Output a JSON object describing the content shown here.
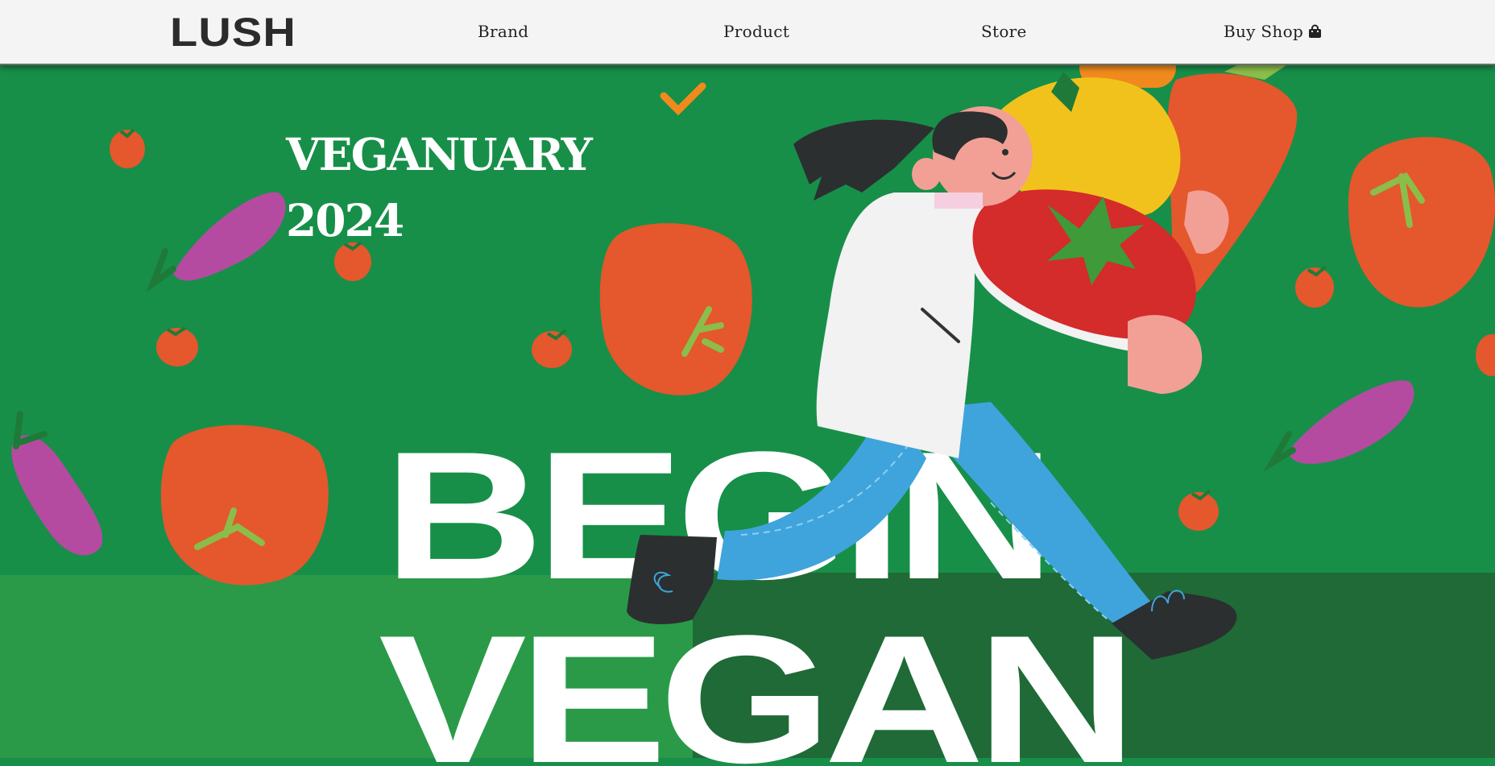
{
  "header": {
    "logo": "LUSH",
    "nav": [
      {
        "label": "Brand"
      },
      {
        "label": "Product"
      },
      {
        "label": "Store"
      },
      {
        "label": "Buy Shop",
        "icon": "shopping-bag-icon"
      }
    ]
  },
  "hero": {
    "title_line1": "VEGANUARY",
    "title_line2": "2024",
    "big_line1": "BEGIN",
    "big_line2": "VEGAN"
  },
  "colors": {
    "background_green": "#178f49",
    "ground_green": "#2a9a48",
    "dark_green": "#1f6a36",
    "tomato": "#e5572c",
    "eggplant": "#b44ba0",
    "jeans": "#3fa4dc",
    "header_bg": "#f4f4f4"
  }
}
